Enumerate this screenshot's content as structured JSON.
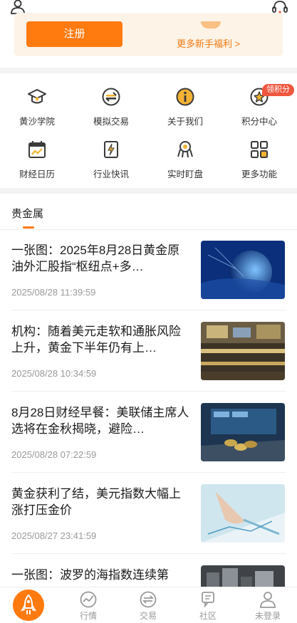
{
  "header": {
    "left_icon": "user-icon",
    "right_icon": "customer-service-icon"
  },
  "promo": {
    "register_label": "注册",
    "more_benefits": "更多新手福利 >"
  },
  "grid": {
    "items": [
      {
        "label": "黄沙学院",
        "icon": "graduation-cap-icon"
      },
      {
        "label": "模拟交易",
        "icon": "exchange-icon"
      },
      {
        "label": "关于我们",
        "icon": "info-icon"
      },
      {
        "label": "积分中心",
        "icon": "star-icon"
      },
      {
        "label": "财经日历",
        "icon": "calendar-icon"
      },
      {
        "label": "行业快讯",
        "icon": "flash-news-icon"
      },
      {
        "label": "实时盯盘",
        "icon": "monitor-icon"
      },
      {
        "label": "更多功能",
        "icon": "more-grid-icon"
      }
    ],
    "badge": "领积分"
  },
  "section": {
    "title": "贵金属"
  },
  "news": [
    {
      "title": "一张图：2025年8月28日黄金原油外汇股指“枢纽点+多…",
      "time": "2025/08/28 11:39:59"
    },
    {
      "title": "机构：随着美元走软和通胀风险上升，黄金下半年仍有上…",
      "time": "2025/08/28 10:34:59"
    },
    {
      "title": "8月28日财经早餐：美联储主席人选将在金秋揭晓，避险…",
      "time": "2025/08/28 07:22:59"
    },
    {
      "title": "黄金获利了结，美元指数大幅上涨打压金价",
      "time": "2025/08/27 23:41:59"
    },
    {
      "title": "一张图：波罗的海指数连续第",
      "time": ""
    }
  ],
  "tabbar": {
    "tabs": [
      {
        "label": "行情",
        "icon": "chart-icon"
      },
      {
        "label": "交易",
        "icon": "exchange-icon"
      },
      {
        "label": "社区",
        "icon": "chat-icon"
      },
      {
        "label": "未登录",
        "icon": "user-icon"
      }
    ],
    "home_icon": "rocket-icon"
  },
  "colors": {
    "accent": "#ff7a0f",
    "badge": "#f0573f",
    "icon_dark": "#3a3a3a",
    "icon_yellow": "#f3b233"
  }
}
